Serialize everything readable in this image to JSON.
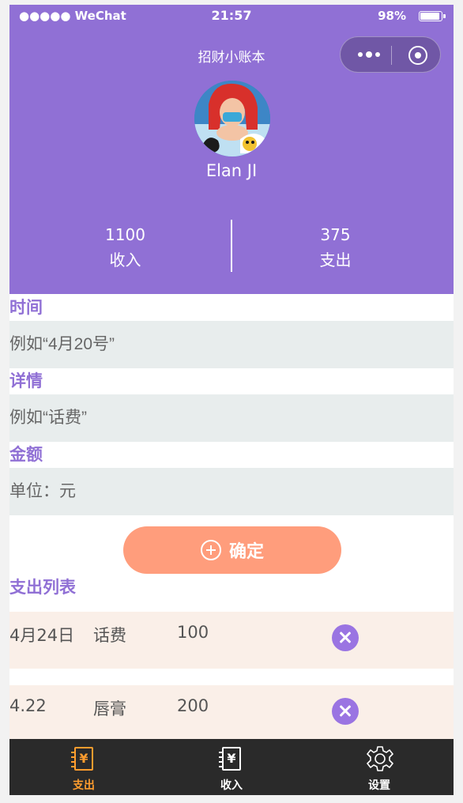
{
  "status_bar": {
    "carrier": "●●●●● WeChat",
    "time": "21:57",
    "battery": "98%",
    "battery_level": 0.98
  },
  "nav": {
    "title": "招财小账本"
  },
  "profile": {
    "username": "Elan JI"
  },
  "stats": {
    "income": {
      "value": "1100",
      "label": "收入"
    },
    "expense": {
      "value": "375",
      "label": "支出"
    }
  },
  "form": {
    "time_label": "时间",
    "time_placeholder": "例如“4月20号”",
    "detail_label": "详情",
    "detail_placeholder": "例如“话费”",
    "amount_label": "金额",
    "amount_placeholder": "单位：元",
    "confirm_label": "确定"
  },
  "list": {
    "title": "支出列表",
    "rows": [
      {
        "date": "4月24日",
        "detail": "话费",
        "amount": "100"
      },
      {
        "date": "4.22",
        "detail": "唇膏",
        "amount": "200"
      }
    ]
  },
  "tabbar": {
    "items": [
      {
        "label": "支出",
        "icon": "ledger-icon",
        "active": true
      },
      {
        "label": "收入",
        "icon": "ledger-icon",
        "active": false
      },
      {
        "label": "设置",
        "icon": "gear-icon",
        "active": false
      }
    ],
    "active_color": "#ff9d2e",
    "inactive_color": "#ffffff"
  },
  "colors": {
    "accent": "#9070d5",
    "button": "#ff9d7c",
    "field_bg": "#e8eded",
    "row_bg": "#faefe8"
  }
}
